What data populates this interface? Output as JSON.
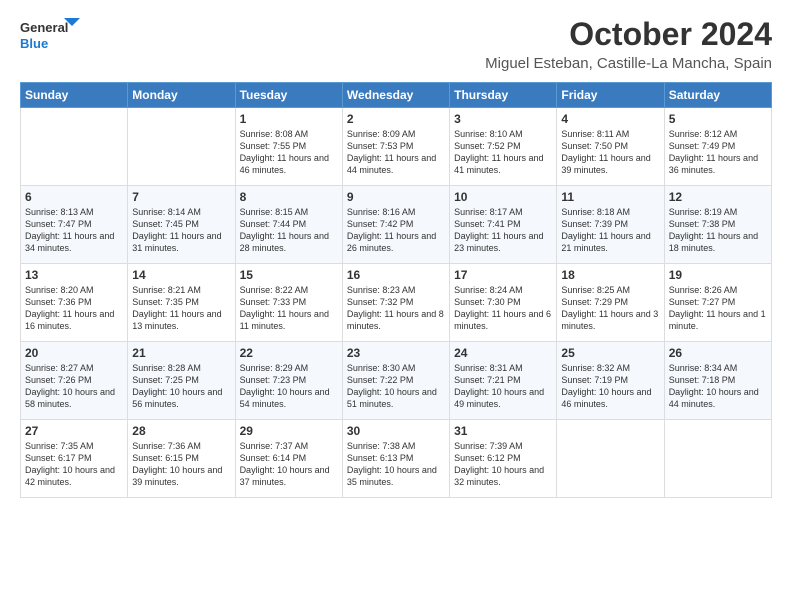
{
  "logo": {
    "text1": "General",
    "text2": "Blue"
  },
  "title": "October 2024",
  "subtitle": "Miguel Esteban, Castille-La Mancha, Spain",
  "headers": [
    "Sunday",
    "Monday",
    "Tuesday",
    "Wednesday",
    "Thursday",
    "Friday",
    "Saturday"
  ],
  "weeks": [
    [
      {
        "day": "",
        "info": ""
      },
      {
        "day": "",
        "info": ""
      },
      {
        "day": "1",
        "info": "Sunrise: 8:08 AM\nSunset: 7:55 PM\nDaylight: 11 hours and 46 minutes."
      },
      {
        "day": "2",
        "info": "Sunrise: 8:09 AM\nSunset: 7:53 PM\nDaylight: 11 hours and 44 minutes."
      },
      {
        "day": "3",
        "info": "Sunrise: 8:10 AM\nSunset: 7:52 PM\nDaylight: 11 hours and 41 minutes."
      },
      {
        "day": "4",
        "info": "Sunrise: 8:11 AM\nSunset: 7:50 PM\nDaylight: 11 hours and 39 minutes."
      },
      {
        "day": "5",
        "info": "Sunrise: 8:12 AM\nSunset: 7:49 PM\nDaylight: 11 hours and 36 minutes."
      }
    ],
    [
      {
        "day": "6",
        "info": "Sunrise: 8:13 AM\nSunset: 7:47 PM\nDaylight: 11 hours and 34 minutes."
      },
      {
        "day": "7",
        "info": "Sunrise: 8:14 AM\nSunset: 7:45 PM\nDaylight: 11 hours and 31 minutes."
      },
      {
        "day": "8",
        "info": "Sunrise: 8:15 AM\nSunset: 7:44 PM\nDaylight: 11 hours and 28 minutes."
      },
      {
        "day": "9",
        "info": "Sunrise: 8:16 AM\nSunset: 7:42 PM\nDaylight: 11 hours and 26 minutes."
      },
      {
        "day": "10",
        "info": "Sunrise: 8:17 AM\nSunset: 7:41 PM\nDaylight: 11 hours and 23 minutes."
      },
      {
        "day": "11",
        "info": "Sunrise: 8:18 AM\nSunset: 7:39 PM\nDaylight: 11 hours and 21 minutes."
      },
      {
        "day": "12",
        "info": "Sunrise: 8:19 AM\nSunset: 7:38 PM\nDaylight: 11 hours and 18 minutes."
      }
    ],
    [
      {
        "day": "13",
        "info": "Sunrise: 8:20 AM\nSunset: 7:36 PM\nDaylight: 11 hours and 16 minutes."
      },
      {
        "day": "14",
        "info": "Sunrise: 8:21 AM\nSunset: 7:35 PM\nDaylight: 11 hours and 13 minutes."
      },
      {
        "day": "15",
        "info": "Sunrise: 8:22 AM\nSunset: 7:33 PM\nDaylight: 11 hours and 11 minutes."
      },
      {
        "day": "16",
        "info": "Sunrise: 8:23 AM\nSunset: 7:32 PM\nDaylight: 11 hours and 8 minutes."
      },
      {
        "day": "17",
        "info": "Sunrise: 8:24 AM\nSunset: 7:30 PM\nDaylight: 11 hours and 6 minutes."
      },
      {
        "day": "18",
        "info": "Sunrise: 8:25 AM\nSunset: 7:29 PM\nDaylight: 11 hours and 3 minutes."
      },
      {
        "day": "19",
        "info": "Sunrise: 8:26 AM\nSunset: 7:27 PM\nDaylight: 11 hours and 1 minute."
      }
    ],
    [
      {
        "day": "20",
        "info": "Sunrise: 8:27 AM\nSunset: 7:26 PM\nDaylight: 10 hours and 58 minutes."
      },
      {
        "day": "21",
        "info": "Sunrise: 8:28 AM\nSunset: 7:25 PM\nDaylight: 10 hours and 56 minutes."
      },
      {
        "day": "22",
        "info": "Sunrise: 8:29 AM\nSunset: 7:23 PM\nDaylight: 10 hours and 54 minutes."
      },
      {
        "day": "23",
        "info": "Sunrise: 8:30 AM\nSunset: 7:22 PM\nDaylight: 10 hours and 51 minutes."
      },
      {
        "day": "24",
        "info": "Sunrise: 8:31 AM\nSunset: 7:21 PM\nDaylight: 10 hours and 49 minutes."
      },
      {
        "day": "25",
        "info": "Sunrise: 8:32 AM\nSunset: 7:19 PM\nDaylight: 10 hours and 46 minutes."
      },
      {
        "day": "26",
        "info": "Sunrise: 8:34 AM\nSunset: 7:18 PM\nDaylight: 10 hours and 44 minutes."
      }
    ],
    [
      {
        "day": "27",
        "info": "Sunrise: 7:35 AM\nSunset: 6:17 PM\nDaylight: 10 hours and 42 minutes."
      },
      {
        "day": "28",
        "info": "Sunrise: 7:36 AM\nSunset: 6:15 PM\nDaylight: 10 hours and 39 minutes."
      },
      {
        "day": "29",
        "info": "Sunrise: 7:37 AM\nSunset: 6:14 PM\nDaylight: 10 hours and 37 minutes."
      },
      {
        "day": "30",
        "info": "Sunrise: 7:38 AM\nSunset: 6:13 PM\nDaylight: 10 hours and 35 minutes."
      },
      {
        "day": "31",
        "info": "Sunrise: 7:39 AM\nSunset: 6:12 PM\nDaylight: 10 hours and 32 minutes."
      },
      {
        "day": "",
        "info": ""
      },
      {
        "day": "",
        "info": ""
      }
    ]
  ]
}
